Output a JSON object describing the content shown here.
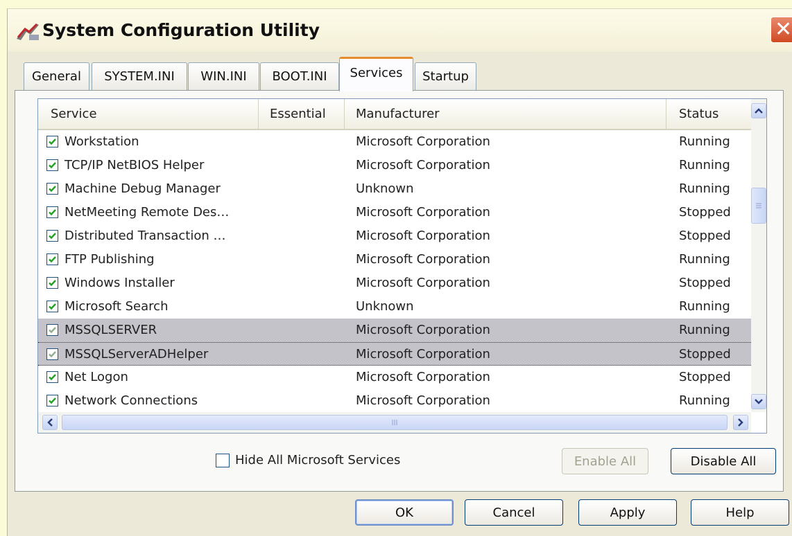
{
  "window": {
    "title": "System Configuration Utility",
    "close_symbol": "✕"
  },
  "tabs": [
    {
      "label": "General"
    },
    {
      "label": "SYSTEM.INI"
    },
    {
      "label": "WIN.INI"
    },
    {
      "label": "BOOT.INI"
    },
    {
      "label": "Services"
    },
    {
      "label": "Startup"
    }
  ],
  "active_tab": "Services",
  "columns": {
    "service": "Service",
    "essential": "Essential",
    "manufacturer": "Manufacturer",
    "status": "Status"
  },
  "rows": [
    {
      "service": "Workstation",
      "essential": "",
      "manufacturer": "Microsoft Corporation",
      "status": "Running",
      "checked": true,
      "selected": false
    },
    {
      "service": "TCP/IP NetBIOS Helper",
      "essential": "",
      "manufacturer": "Microsoft Corporation",
      "status": "Running",
      "checked": true,
      "selected": false
    },
    {
      "service": "Machine Debug Manager",
      "essential": "",
      "manufacturer": "Unknown",
      "status": "Running",
      "checked": true,
      "selected": false
    },
    {
      "service": "NetMeeting Remote Des…",
      "essential": "",
      "manufacturer": "Microsoft Corporation",
      "status": "Stopped",
      "checked": true,
      "selected": false
    },
    {
      "service": "Distributed Transaction …",
      "essential": "",
      "manufacturer": "Microsoft Corporation",
      "status": "Stopped",
      "checked": true,
      "selected": false
    },
    {
      "service": "FTP Publishing",
      "essential": "",
      "manufacturer": "Microsoft Corporation",
      "status": "Running",
      "checked": true,
      "selected": false
    },
    {
      "service": "Windows Installer",
      "essential": "",
      "manufacturer": "Microsoft Corporation",
      "status": "Stopped",
      "checked": true,
      "selected": false
    },
    {
      "service": "Microsoft Search",
      "essential": "",
      "manufacturer": "Unknown",
      "status": "Running",
      "checked": true,
      "selected": false
    },
    {
      "service": "MSSQLSERVER",
      "essential": "",
      "manufacturer": "Microsoft Corporation",
      "status": "Running",
      "checked": true,
      "selected": true
    },
    {
      "service": "MSSQLServerADHelper",
      "essential": "",
      "manufacturer": "Microsoft Corporation",
      "status": "Stopped",
      "checked": true,
      "selected": true
    },
    {
      "service": "Net Logon",
      "essential": "",
      "manufacturer": "Microsoft Corporation",
      "status": "Stopped",
      "checked": true,
      "selected": false
    },
    {
      "service": "Network Connections",
      "essential": "",
      "manufacturer": "Microsoft Corporation",
      "status": "Running",
      "checked": true,
      "selected": false
    }
  ],
  "hide_ms_services": {
    "label": "Hide All Microsoft Services",
    "checked": false
  },
  "buttons": {
    "enable_all": "Enable All",
    "disable_all": "Disable All",
    "ok": "OK",
    "cancel": "Cancel",
    "apply": "Apply",
    "help": "Help"
  },
  "colors": {
    "accent_tab": "#e68b2c",
    "selection": "#c3c3c9",
    "checkmark": "#21a121"
  }
}
